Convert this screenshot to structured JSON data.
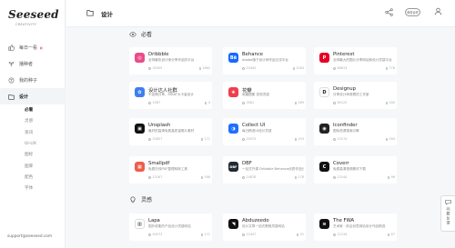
{
  "brand": {
    "logo": "Seeseed",
    "tagline": "CREATIVITY"
  },
  "nav": [
    {
      "label": "每日一看",
      "icon": "thumb-icon",
      "extra": "◐"
    },
    {
      "label": "播种者",
      "icon": "seed-icon"
    },
    {
      "label": "我的种子",
      "icon": "sprout-icon"
    },
    {
      "label": "设计",
      "icon": "folder-icon",
      "active": true
    }
  ],
  "subnav": [
    {
      "label": "必看",
      "active": true
    },
    {
      "label": "灵感"
    },
    {
      "label": "资讯"
    },
    {
      "label": "UI-UX"
    },
    {
      "label": "图标"
    },
    {
      "label": "图库"
    },
    {
      "label": "配色"
    },
    {
      "label": "字体"
    }
  ],
  "support_email": "support@seeseed.com",
  "page_title": "设计",
  "badge": "商务合作",
  "sections": [
    {
      "title": "必看"
    },
    {
      "title": "灵感"
    }
  ],
  "cards": [
    {
      "name": "Dribbble",
      "desc": "全球最热设计师分享作品的平台",
      "views": "35505",
      "saves": "1862",
      "logo_color": "#ea4c89",
      "logo_text": "◎"
    },
    {
      "name": "Behance",
      "desc": "Adobe旗下设计师作品交流平台",
      "views": "10445",
      "saves": "1163",
      "logo_color": "#1769ff",
      "logo_text": "Bē"
    },
    {
      "name": "Pinterest",
      "desc": "全球最大的图片分享网站和设计灵感平台",
      "views": "68613",
      "saves": "776",
      "logo_color": "#e60023",
      "logo_text": "P"
    },
    {
      "name": "设计达人社群",
      "desc": "不定期分享、RIBAT大卡量设计",
      "views": "1567",
      "saves": "4",
      "logo_color": "#3f7ef0",
      "logo_text": "✿"
    },
    {
      "name": "花瓣",
      "desc": "收藏图集 发现灵感",
      "views": "3581",
      "saves": "269",
      "logo_color": "#ef3e4f",
      "logo_text": "❀"
    },
    {
      "name": "Designup",
      "desc": "分享设计师常看的工作室",
      "views": "89125",
      "saves": "180",
      "logo_color": "#ffffff",
      "logo_text": "D"
    },
    {
      "name": "Unsplash",
      "desc": "最好的高清免费高质量照片素材",
      "views": "52857",
      "saves": "171",
      "logo_color": "#111111",
      "logo_text": "▣"
    },
    {
      "name": "Collect UI",
      "desc": "每日精选UI设计灵感",
      "views": "20075",
      "saves": "153",
      "logo_color": "#1f6fff",
      "logo_text": "◑"
    },
    {
      "name": "Iconfinder",
      "desc": "图标资源搜索引擎",
      "views": "13174",
      "saves": "164",
      "logo_color": "#222222",
      "logo_text": "◉"
    },
    {
      "name": "Smallpdf",
      "desc": "免费在线PDF整理转换工具",
      "views": "13167",
      "saves": "166",
      "logo_color": "#ee5d4b",
      "logo_text": "▦"
    },
    {
      "name": "DBF",
      "desc": "一站式开源 Dribbble Behance优质作品分享",
      "views": "14878",
      "saves": "178",
      "logo_color": "#232936",
      "logo_text": "DBF"
    },
    {
      "name": "Coverr",
      "desc": "免费高清视频素材下载",
      "views": "13144",
      "saves": "96",
      "logo_color": "#111111",
      "logo_text": "C"
    },
    {
      "name": "Lapa",
      "desc": "国外收集的产品设计灵感网站",
      "views": "40573",
      "saves": "171",
      "logo_color": "#ffffff",
      "logo_text": "▥"
    },
    {
      "name": "Abduzeedo",
      "desc": "设计文章一站式教程灵感网站",
      "views": "12447",
      "saves": "51",
      "logo_color": "#111111",
      "logo_text": "◥"
    },
    {
      "name": "The FWA",
      "desc": "艺术家 · 前沿创意网站设计作品精选",
      "views": "12134",
      "saves": "67",
      "logo_color": "#111111",
      "logo_text": "≋"
    }
  ],
  "float_button": "问题反馈"
}
